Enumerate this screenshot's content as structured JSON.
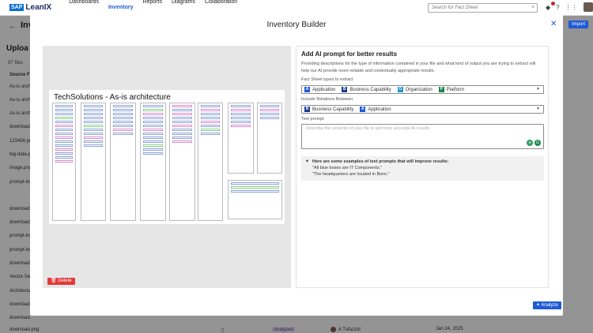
{
  "app": {
    "sap": "SAP",
    "name": "LeanIX"
  },
  "nav": [
    "Dashboards",
    "Inventory",
    "Reports",
    "Diagrams",
    "Collaboration"
  ],
  "search": {
    "placeholder": "Search for Fact Sheet"
  },
  "notifications": {
    "count": "9+"
  },
  "background": {
    "title": "Inv",
    "subtitle": "Uploa",
    "files_count": "97 files",
    "column_header": "Source Fi",
    "import_label": "Import",
    "rows": [
      "As-is archite",
      "As-is archit",
      "As-is archit",
      "download-",
      "123456.pn",
      "big-data-p",
      "image.png",
      "prompt-inp",
      "download3",
      "download3",
      "prompt-inp",
      "prompt-inp",
      "download3",
      "Vector-Sea",
      "Architectu",
      "download.",
      "download.",
      "download.png"
    ],
    "last_row": {
      "status": "Analyzed",
      "user": "A Tufazzul",
      "date": "Jan 24, 2025"
    }
  },
  "modal": {
    "title": "Inventory Builder",
    "preview": {
      "doc_title": "TechSolutions - As-is architecture",
      "delete_label": "Delete"
    },
    "prompt": {
      "heading": "Add AI prompt for better results",
      "description": "Providing descriptions for the type of information contained in your file and what kind of output you are trying to extract will help our AI provide more reliable and contextually appropriate results.",
      "fact_types_label": "Fact Sheet types to extract",
      "fact_types": [
        {
          "letter": "A",
          "label": "Application",
          "color": "#1f5ad6"
        },
        {
          "letter": "B",
          "label": "Business Capability",
          "color": "#1a3c8c"
        },
        {
          "letter": "O",
          "label": "Organization",
          "color": "#2196c9"
        },
        {
          "letter": "P",
          "label": "Platform",
          "color": "#1e7f4a"
        }
      ],
      "relations_label": "Include Relations Between",
      "relations": [
        {
          "letter": "B",
          "label": "Business Capability",
          "color": "#1a3c8c"
        },
        {
          "letter": "A",
          "label": "Application",
          "color": "#1f5ad6"
        }
      ],
      "text_prompt_label": "Text prompt",
      "text_prompt_placeholder": "Describe the contents of your file to get more accurate AI results.",
      "tips_heading": "Here are some examples of text prompts that will improve results:",
      "tips": [
        "\"All blue boxes are IT Components.\"",
        "\"The headquarters are located in Bonn.\""
      ]
    },
    "analyze_label": "Analyze"
  }
}
